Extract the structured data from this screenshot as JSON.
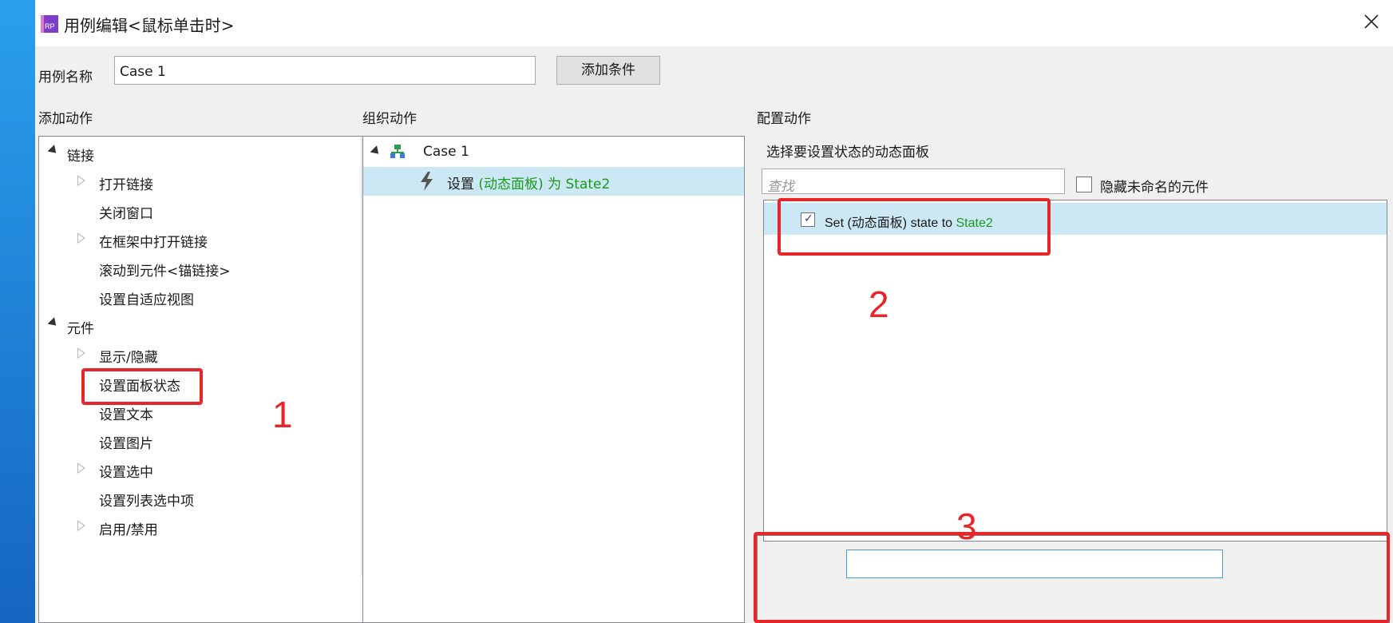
{
  "dialog": {
    "title": "用例编辑<鼠标单击时>",
    "app_icon_text": "RP"
  },
  "case_name": {
    "label": "用例名称",
    "value": "Case 1",
    "add_condition_button": "添加条件"
  },
  "sections": {
    "add_actions": "添加动作",
    "organize_actions": "组织动作",
    "configure_actions": "配置动作"
  },
  "action_tree": [
    {
      "label": "链接",
      "level": 0,
      "expander": "open"
    },
    {
      "label": "打开链接",
      "level": 1,
      "expander": "closed"
    },
    {
      "label": "关闭窗口",
      "level": 1,
      "expander": "none"
    },
    {
      "label": "在框架中打开链接",
      "level": 1,
      "expander": "closed"
    },
    {
      "label": "滚动到元件<锚链接>",
      "level": 1,
      "expander": "none"
    },
    {
      "label": "设置自适应视图",
      "level": 1,
      "expander": "none"
    },
    {
      "label": "元件",
      "level": 0,
      "expander": "open"
    },
    {
      "label": "显示/隐藏",
      "level": 1,
      "expander": "closed"
    },
    {
      "label": "设置面板状态",
      "level": 1,
      "expander": "none"
    },
    {
      "label": "设置文本",
      "level": 1,
      "expander": "none"
    },
    {
      "label": "设置图片",
      "level": 1,
      "expander": "none"
    },
    {
      "label": "设置选中",
      "level": 1,
      "expander": "closed"
    },
    {
      "label": "设置列表选中项",
      "level": 1,
      "expander": "none"
    },
    {
      "label": "启用/禁用",
      "level": 1,
      "expander": "closed"
    }
  ],
  "organize": {
    "case_label": "Case 1",
    "action_prefix": "设置 ",
    "action_target": "(动态面板) 为 State2"
  },
  "configure": {
    "heading": "选择要设置状态的动态面板",
    "search_placeholder": "查找",
    "hide_unnamed_label": "隐藏未命名的元件",
    "item_prefix": "Set (动态面板) state to ",
    "item_state": "State2",
    "item_checked": true
  },
  "annotations": [
    "1",
    "2",
    "3"
  ],
  "colors": {
    "annotation_red": "#e8262a",
    "selection_blue": "#cce8f4",
    "green_text": "#1a9a1a",
    "app_purple": "#7e3ec8"
  }
}
